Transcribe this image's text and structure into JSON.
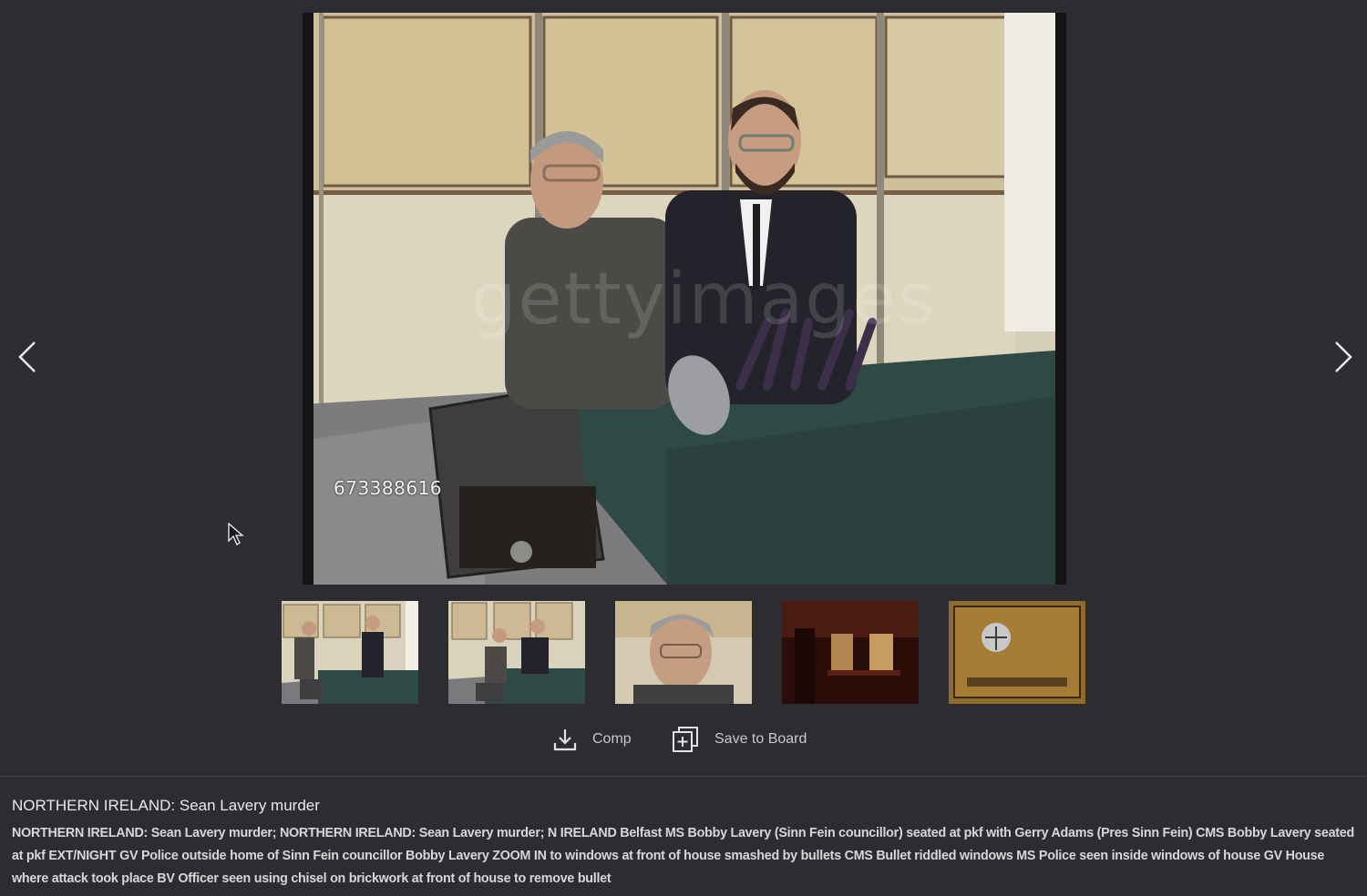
{
  "viewer": {
    "prev_icon": "chevron-left-icon",
    "next_icon": "chevron-right-icon",
    "main_frame": {
      "frame_id": "673388616",
      "watermark": "gettyimages"
    },
    "thumbnails": [
      {
        "label": "thumbnail-1"
      },
      {
        "label": "thumbnail-2"
      },
      {
        "label": "thumbnail-3"
      },
      {
        "label": "thumbnail-4"
      },
      {
        "label": "thumbnail-5"
      }
    ]
  },
  "actions": {
    "comp_label": "Comp",
    "comp_icon": "download-icon",
    "save_label": "Save to Board",
    "save_icon": "add-to-board-icon"
  },
  "info": {
    "title": "NORTHERN IRELAND: Sean Lavery murder",
    "description": "NORTHERN IRELAND: Sean Lavery murder; NORTHERN IRELAND: Sean Lavery murder; N IRELAND Belfast MS Bobby Lavery (Sinn Fein councillor) seated at pkf with Gerry Adams (Pres Sinn Fein) CMS Bobby Lavery seated at pkf EXT/NIGHT GV Police outside home of Sinn Fein councillor Bobby Lavery ZOOM IN to windows at front of house smashed by bullets CMS Bullet riddled windows MS Police seen inside windows of house GV House where attack took place BV Officer seen using chisel on brickwork at front of house to remove bullet"
  },
  "colors": {
    "background": "#2d2c30",
    "text": "#d7d7d9",
    "table_cloth": "#2f4a45"
  }
}
